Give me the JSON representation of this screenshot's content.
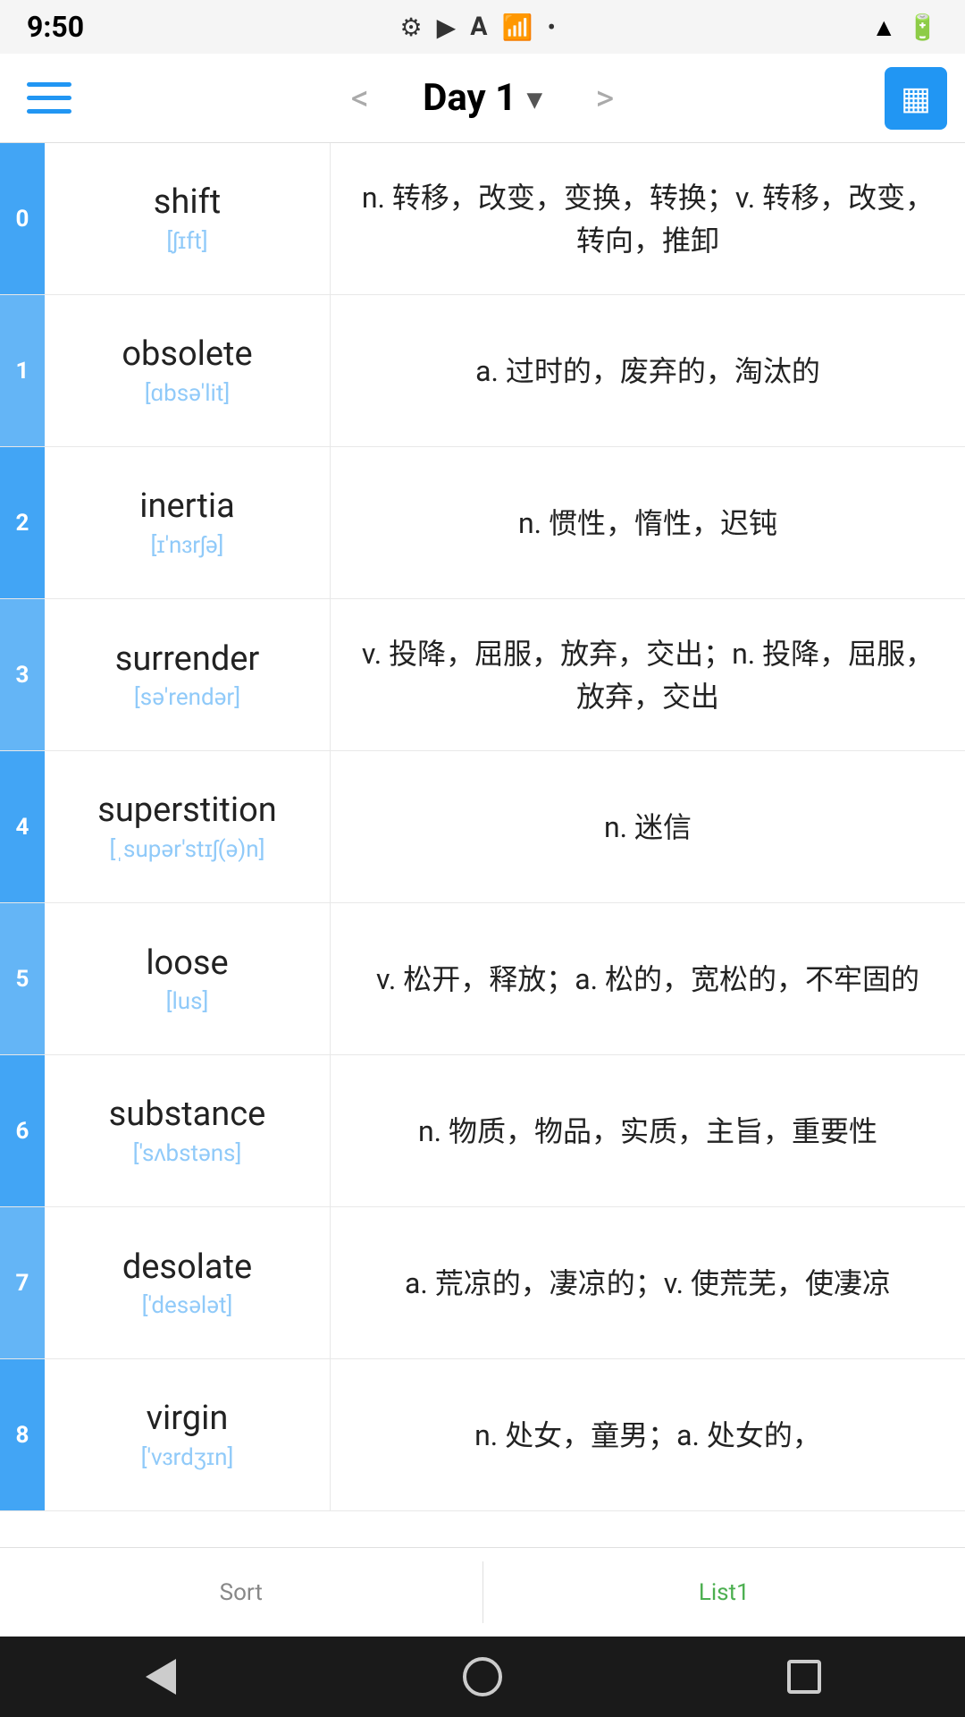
{
  "statusBar": {
    "time": "9:50",
    "icons": [
      "gear",
      "play",
      "font",
      "wifi",
      "dot"
    ]
  },
  "header": {
    "menuLabel": "menu",
    "prevLabel": "<",
    "title": "Day 1",
    "dropdownLabel": "▾",
    "nextLabel": ">",
    "gridLabel": "grid"
  },
  "words": [
    {
      "index": "0",
      "english": "shift",
      "phonetic": "[ʃɪft]",
      "definition": "n. 转移，改变，变换，转换；v. 转移，改变，转向，推卸"
    },
    {
      "index": "1",
      "english": "obsolete",
      "phonetic": "[ɑbsə'lit]",
      "definition": "a. 过时的，废弃的，淘汰的"
    },
    {
      "index": "2",
      "english": "inertia",
      "phonetic": "[ɪ'nɜrʃə]",
      "definition": "n. 惯性，惰性，迟钝"
    },
    {
      "index": "3",
      "english": "surrender",
      "phonetic": "[sə'rendər]",
      "definition": "v. 投降，屈服，放弃，交出；n. 投降，屈服，放弃，交出"
    },
    {
      "index": "4",
      "english": "superstition",
      "phonetic": "[ˌsupər'stɪʃ(ə)n]",
      "definition": "n. 迷信"
    },
    {
      "index": "5",
      "english": "loose",
      "phonetic": "[lus]",
      "definition": "v. 松开，释放；a. 松的，宽松的，不牢固的"
    },
    {
      "index": "6",
      "english": "substance",
      "phonetic": "['sʌbstəns]",
      "definition": "n. 物质，物品，实质，主旨，重要性"
    },
    {
      "index": "7",
      "english": "desolate",
      "phonetic": "['desələt]",
      "definition": "a. 荒凉的，凄凉的；v. 使荒芜，使凄凉"
    },
    {
      "index": "8",
      "english": "virgin",
      "phonetic": "['vɜrdʒɪn]",
      "definition": "n. 处女，童男；a. 处女的，"
    }
  ],
  "bottomTabs": [
    {
      "label": "Sort",
      "active": false
    },
    {
      "label": "List1",
      "active": true
    }
  ],
  "androidNav": {
    "back": "back",
    "home": "home",
    "recent": "recent"
  }
}
